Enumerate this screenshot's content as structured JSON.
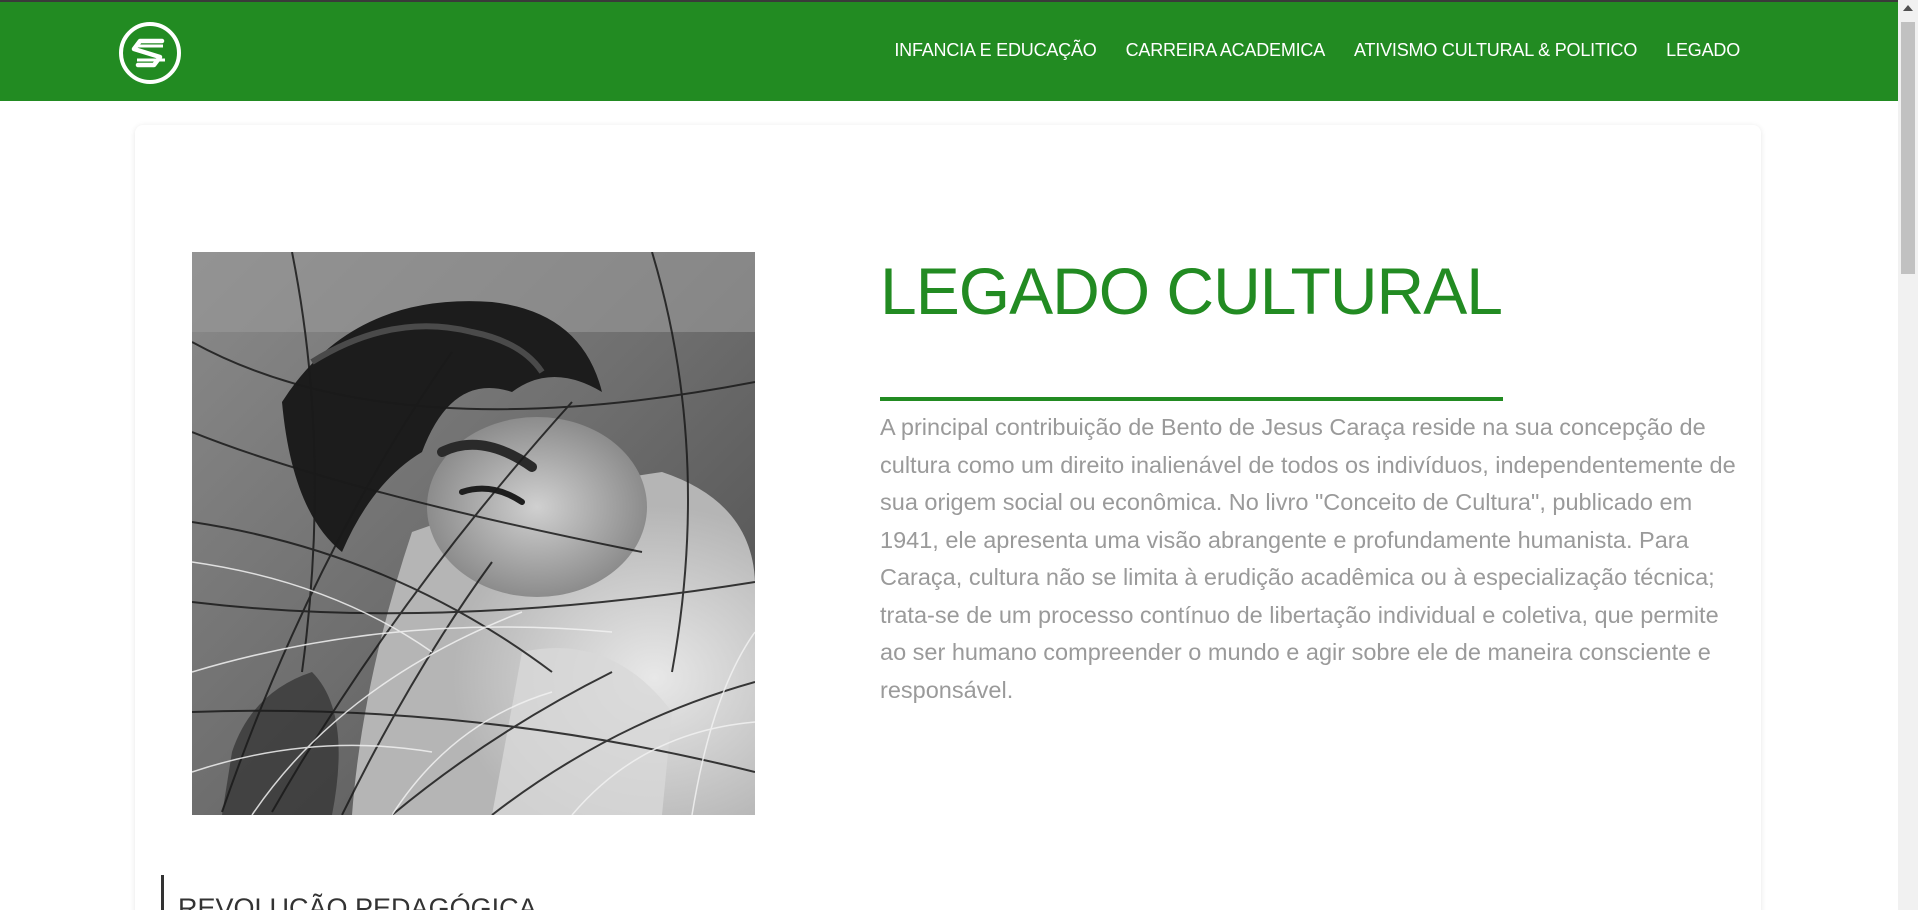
{
  "nav": {
    "logo_icon": "circle-s-logo-icon",
    "links": [
      {
        "label": "INFANCIA E EDUCAÇÃO"
      },
      {
        "label": "CARREIRA ACADEMICA"
      },
      {
        "label": "ATIVISMO CULTURAL & POLITICO"
      },
      {
        "label": "LEGADO"
      }
    ]
  },
  "main": {
    "title": "LEGADO CULTURAL",
    "photo_alt": "Foto em preto e branco de Bento de Jesus Caraça deitado na relva",
    "paragraph": "A principal contribuição de Bento de Jesus Caraça reside na sua concepção de cultura como um direito inalienável de todos os indivíduos, independentemente de sua origem social ou econômica. No livro \"Conceito de Cultura\", publicado em 1941, ele apresenta uma visão abrangente e profundamente humanista. Para Caraça, cultura não se limita à erudição acadêmica ou à especialização técnica; trata-se de um processo contínuo de libertação individual e coletiva, que permite ao ser humano compreender o mundo e agir sobre ele de maneira consciente e responsável.",
    "section_heading": "REVOLUÇÃO PEDAGÓGICA"
  },
  "colors": {
    "accent": "#228b22",
    "body_text": "#9a9a9a",
    "heading_dark": "#333333"
  }
}
